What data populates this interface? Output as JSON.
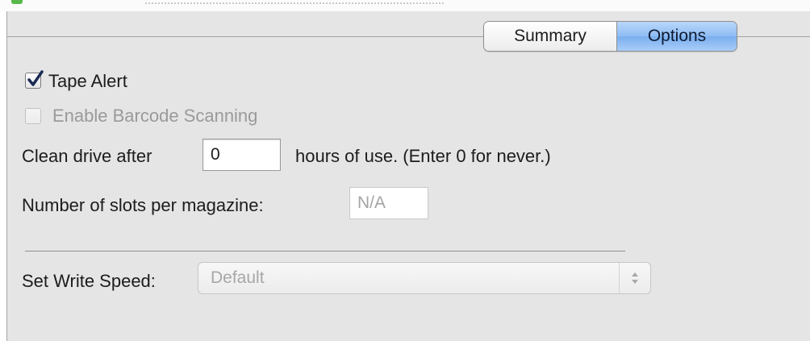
{
  "tabs": [
    {
      "label": "Summary",
      "selected": false
    },
    {
      "label": "Options",
      "selected": true
    }
  ],
  "options": {
    "tape_alert": {
      "label": "Tape Alert",
      "checked": true,
      "enabled": true
    },
    "barcode_scanning": {
      "label": "Enable Barcode Scanning",
      "checked": false,
      "enabled": false
    },
    "clean_drive": {
      "prefix": "Clean drive after",
      "value": "0",
      "suffix": "hours of use. (Enter 0 for never.)"
    },
    "slots": {
      "label": "Number of slots per magazine:",
      "value": "N/A",
      "enabled": false
    },
    "write_speed": {
      "label": "Set Write Speed:",
      "value": "Default",
      "enabled": false
    }
  },
  "colors": {
    "panel_bg": "#e5e5e5",
    "selected_tab": "#8fbcf3",
    "checkmark": "#1a2b55",
    "disabled_text": "#9a9a9a"
  },
  "icons": {
    "checkbox_mark": "checkmark-icon",
    "popup_arrows": "up-down-arrows-icon"
  }
}
